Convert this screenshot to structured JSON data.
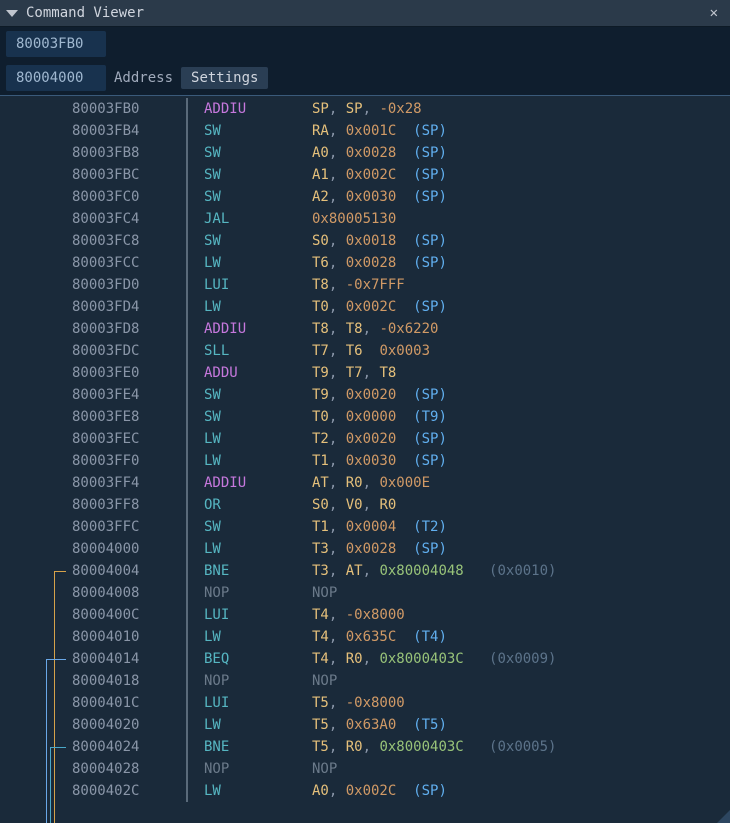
{
  "window": {
    "title": "Command Viewer",
    "close_glyph": "✕"
  },
  "toolbar": {
    "addr1": "80003FB0",
    "addr2": "80004000",
    "addr_label": "Address",
    "settings_label": "Settings"
  },
  "disasm": [
    {
      "addr": "80003FB0",
      "op": "ADDIU",
      "op_cls": "tk-op",
      "args": [
        [
          "reg",
          "SP"
        ],
        [
          "pun",
          ", "
        ],
        [
          "reg",
          "SP"
        ],
        [
          "pun",
          ", "
        ],
        [
          "num",
          "-0x28"
        ]
      ]
    },
    {
      "addr": "80003FB4",
      "op": "SW",
      "op_cls": "tk-op2",
      "args": [
        [
          "reg",
          "RA"
        ],
        [
          "pun",
          ", "
        ],
        [
          "num",
          "0x001C"
        ],
        [
          "pun",
          "  "
        ],
        [
          "spn",
          "(SP)"
        ]
      ]
    },
    {
      "addr": "80003FB8",
      "op": "SW",
      "op_cls": "tk-op2",
      "args": [
        [
          "reg",
          "A0"
        ],
        [
          "pun",
          ", "
        ],
        [
          "num",
          "0x0028"
        ],
        [
          "pun",
          "  "
        ],
        [
          "spn",
          "(SP)"
        ]
      ]
    },
    {
      "addr": "80003FBC",
      "op": "SW",
      "op_cls": "tk-op2",
      "args": [
        [
          "reg",
          "A1"
        ],
        [
          "pun",
          ", "
        ],
        [
          "num",
          "0x002C"
        ],
        [
          "pun",
          "  "
        ],
        [
          "spn",
          "(SP)"
        ]
      ]
    },
    {
      "addr": "80003FC0",
      "op": "SW",
      "op_cls": "tk-op2",
      "args": [
        [
          "reg",
          "A2"
        ],
        [
          "pun",
          ", "
        ],
        [
          "num",
          "0x0030"
        ],
        [
          "pun",
          "  "
        ],
        [
          "spn",
          "(SP)"
        ]
      ]
    },
    {
      "addr": "80003FC4",
      "op": "JAL",
      "op_cls": "tk-op2",
      "args": [
        [
          "num",
          "0x80005130"
        ]
      ]
    },
    {
      "addr": "80003FC8",
      "op": "SW",
      "op_cls": "tk-op2",
      "args": [
        [
          "reg",
          "S0"
        ],
        [
          "pun",
          ", "
        ],
        [
          "num",
          "0x0018"
        ],
        [
          "pun",
          "  "
        ],
        [
          "spn",
          "(SP)"
        ]
      ]
    },
    {
      "addr": "80003FCC",
      "op": "LW",
      "op_cls": "tk-op2",
      "args": [
        [
          "reg",
          "T6"
        ],
        [
          "pun",
          ", "
        ],
        [
          "num",
          "0x0028"
        ],
        [
          "pun",
          "  "
        ],
        [
          "spn",
          "(SP)"
        ]
      ]
    },
    {
      "addr": "80003FD0",
      "op": "LUI",
      "op_cls": "tk-op2",
      "args": [
        [
          "reg",
          "T8"
        ],
        [
          "pun",
          ", "
        ],
        [
          "num",
          "-0x7FFF"
        ]
      ]
    },
    {
      "addr": "80003FD4",
      "op": "LW",
      "op_cls": "tk-op2",
      "args": [
        [
          "reg",
          "T0"
        ],
        [
          "pun",
          ", "
        ],
        [
          "num",
          "0x002C"
        ],
        [
          "pun",
          "  "
        ],
        [
          "spn",
          "(SP)"
        ]
      ]
    },
    {
      "addr": "80003FD8",
      "op": "ADDIU",
      "op_cls": "tk-op",
      "args": [
        [
          "reg",
          "T8"
        ],
        [
          "pun",
          ", "
        ],
        [
          "reg",
          "T8"
        ],
        [
          "pun",
          ", "
        ],
        [
          "num",
          "-0x6220"
        ]
      ]
    },
    {
      "addr": "80003FDC",
      "op": "SLL",
      "op_cls": "tk-op2",
      "args": [
        [
          "reg",
          "T7"
        ],
        [
          "pun",
          ", "
        ],
        [
          "reg",
          "T6"
        ],
        [
          "pun",
          "  "
        ],
        [
          "num",
          "0x0003"
        ]
      ]
    },
    {
      "addr": "80003FE0",
      "op": "ADDU",
      "op_cls": "tk-op",
      "args": [
        [
          "reg",
          "T9"
        ],
        [
          "pun",
          ", "
        ],
        [
          "reg",
          "T7"
        ],
        [
          "pun",
          ", "
        ],
        [
          "reg",
          "T8"
        ]
      ]
    },
    {
      "addr": "80003FE4",
      "op": "SW",
      "op_cls": "tk-op2",
      "args": [
        [
          "reg",
          "T9"
        ],
        [
          "pun",
          ", "
        ],
        [
          "num",
          "0x0020"
        ],
        [
          "pun",
          "  "
        ],
        [
          "spn",
          "(SP)"
        ]
      ]
    },
    {
      "addr": "80003FE8",
      "op": "SW",
      "op_cls": "tk-op2",
      "args": [
        [
          "reg",
          "T0"
        ],
        [
          "pun",
          ", "
        ],
        [
          "num",
          "0x0000"
        ],
        [
          "pun",
          "  "
        ],
        [
          "spn",
          "(T9)"
        ]
      ]
    },
    {
      "addr": "80003FEC",
      "op": "LW",
      "op_cls": "tk-op2",
      "args": [
        [
          "reg",
          "T2"
        ],
        [
          "pun",
          ", "
        ],
        [
          "num",
          "0x0020"
        ],
        [
          "pun",
          "  "
        ],
        [
          "spn",
          "(SP)"
        ]
      ]
    },
    {
      "addr": "80003FF0",
      "op": "LW",
      "op_cls": "tk-op2",
      "args": [
        [
          "reg",
          "T1"
        ],
        [
          "pun",
          ", "
        ],
        [
          "num",
          "0x0030"
        ],
        [
          "pun",
          "  "
        ],
        [
          "spn",
          "(SP)"
        ]
      ]
    },
    {
      "addr": "80003FF4",
      "op": "ADDIU",
      "op_cls": "tk-op",
      "args": [
        [
          "reg",
          "AT"
        ],
        [
          "pun",
          ", "
        ],
        [
          "reg",
          "R0"
        ],
        [
          "pun",
          ", "
        ],
        [
          "num",
          "0x000E"
        ]
      ]
    },
    {
      "addr": "80003FF8",
      "op": "OR",
      "op_cls": "tk-op2",
      "args": [
        [
          "reg",
          "S0"
        ],
        [
          "pun",
          ", "
        ],
        [
          "reg",
          "V0"
        ],
        [
          "pun",
          ", "
        ],
        [
          "reg",
          "R0"
        ]
      ]
    },
    {
      "addr": "80003FFC",
      "op": "SW",
      "op_cls": "tk-op2",
      "args": [
        [
          "reg",
          "T1"
        ],
        [
          "pun",
          ", "
        ],
        [
          "num",
          "0x0004"
        ],
        [
          "pun",
          "  "
        ],
        [
          "spn",
          "(T2)"
        ]
      ]
    },
    {
      "addr": "80004000",
      "op": "LW",
      "op_cls": "tk-op2",
      "args": [
        [
          "reg",
          "T3"
        ],
        [
          "pun",
          ", "
        ],
        [
          "num",
          "0x0028"
        ],
        [
          "pun",
          "  "
        ],
        [
          "spn",
          "(SP)"
        ]
      ]
    },
    {
      "addr": "80004004",
      "op": "BNE",
      "op_cls": "tk-op2",
      "args": [
        [
          "reg",
          "T3"
        ],
        [
          "pun",
          ", "
        ],
        [
          "reg",
          "AT"
        ],
        [
          "pun",
          ", "
        ],
        [
          "tgt",
          "0x80004048"
        ],
        [
          "pun",
          "   "
        ],
        [
          "off",
          "(0x0010)"
        ]
      ]
    },
    {
      "addr": "80004008",
      "op": "NOP",
      "op_cls": "tk-dim",
      "args": [
        [
          "dim",
          "NOP"
        ]
      ]
    },
    {
      "addr": "8000400C",
      "op": "LUI",
      "op_cls": "tk-op2",
      "args": [
        [
          "reg",
          "T4"
        ],
        [
          "pun",
          ", "
        ],
        [
          "num",
          "-0x8000"
        ]
      ]
    },
    {
      "addr": "80004010",
      "op": "LW",
      "op_cls": "tk-op2",
      "args": [
        [
          "reg",
          "T4"
        ],
        [
          "pun",
          ", "
        ],
        [
          "num",
          "0x635C"
        ],
        [
          "pun",
          "  "
        ],
        [
          "spn",
          "(T4)"
        ]
      ]
    },
    {
      "addr": "80004014",
      "op": "BEQ",
      "op_cls": "tk-op2",
      "args": [
        [
          "reg",
          "T4"
        ],
        [
          "pun",
          ", "
        ],
        [
          "reg",
          "R0"
        ],
        [
          "pun",
          ", "
        ],
        [
          "tgt",
          "0x8000403C"
        ],
        [
          "pun",
          "   "
        ],
        [
          "off",
          "(0x0009)"
        ]
      ]
    },
    {
      "addr": "80004018",
      "op": "NOP",
      "op_cls": "tk-dim",
      "args": [
        [
          "dim",
          "NOP"
        ]
      ]
    },
    {
      "addr": "8000401C",
      "op": "LUI",
      "op_cls": "tk-op2",
      "args": [
        [
          "reg",
          "T5"
        ],
        [
          "pun",
          ", "
        ],
        [
          "num",
          "-0x8000"
        ]
      ]
    },
    {
      "addr": "80004020",
      "op": "LW",
      "op_cls": "tk-op2",
      "args": [
        [
          "reg",
          "T5"
        ],
        [
          "pun",
          ", "
        ],
        [
          "num",
          "0x63A0"
        ],
        [
          "pun",
          "  "
        ],
        [
          "spn",
          "(T5)"
        ]
      ]
    },
    {
      "addr": "80004024",
      "op": "BNE",
      "op_cls": "tk-op2",
      "args": [
        [
          "reg",
          "T5"
        ],
        [
          "pun",
          ", "
        ],
        [
          "reg",
          "R0"
        ],
        [
          "pun",
          ", "
        ],
        [
          "tgt",
          "0x8000403C"
        ],
        [
          "pun",
          "   "
        ],
        [
          "off",
          "(0x0005)"
        ]
      ]
    },
    {
      "addr": "80004028",
      "op": "NOP",
      "op_cls": "tk-dim",
      "args": [
        [
          "dim",
          "NOP"
        ]
      ]
    },
    {
      "addr": "8000402C",
      "op": "LW",
      "op_cls": "tk-op2",
      "args": [
        [
          "reg",
          "A0"
        ],
        [
          "pun",
          ", "
        ],
        [
          "num",
          "0x002C"
        ],
        [
          "pun",
          "  "
        ],
        [
          "spn",
          "(SP)"
        ]
      ]
    }
  ],
  "branch_colors": {
    "line1": "#d6a24a",
    "line2": "#6aa8e8",
    "line3": "#4aa8c8"
  }
}
